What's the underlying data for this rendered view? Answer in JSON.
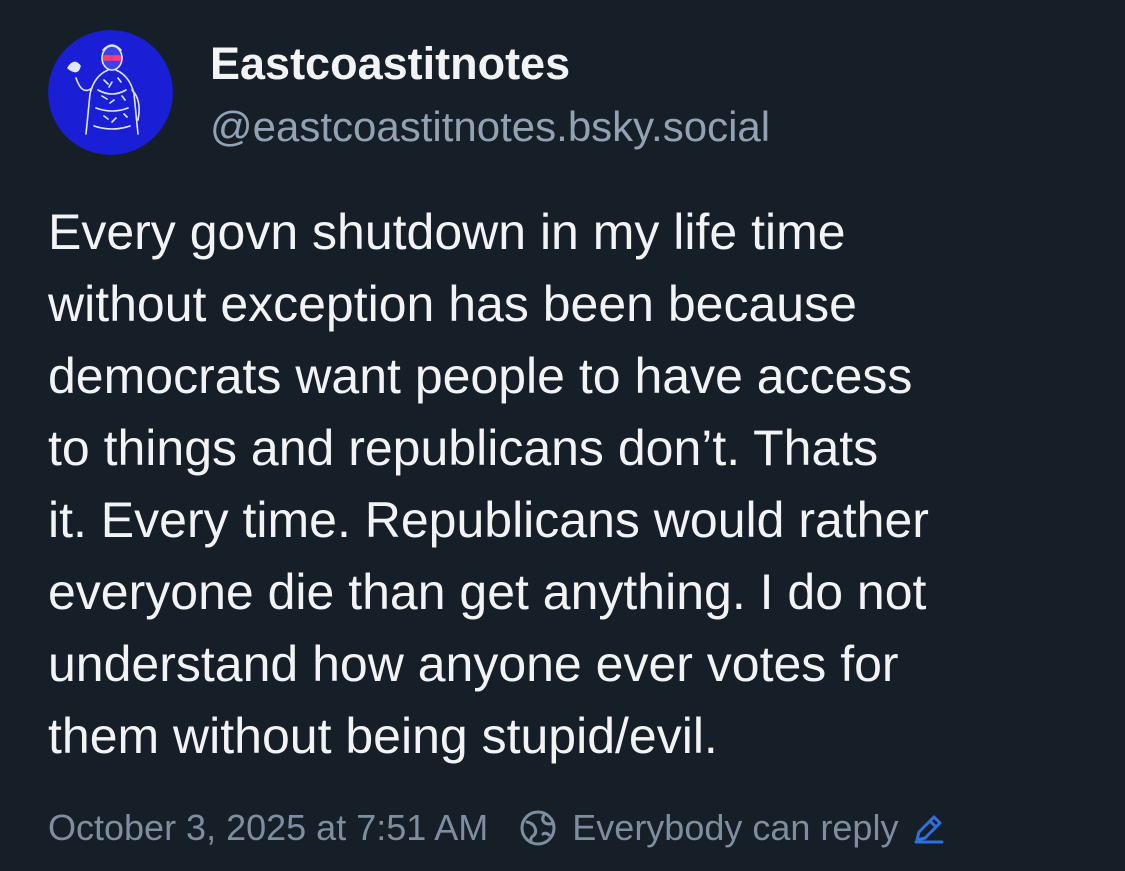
{
  "author": {
    "display_name": "Eastcoastitnotes",
    "handle": "@eastcoastitnotes.bsky.social",
    "avatar_icon": "avatar-icon"
  },
  "post": {
    "lines": [
      "Every govn shutdown in my life time",
      "without exception has been because",
      "democrats want people to have access",
      "to things and republicans don’t. Thats",
      "it. Every time. Republicans would rather",
      "everyone die than get anything. I do not",
      "understand how anyone ever votes for",
      "them without being stupid/evil."
    ]
  },
  "meta": {
    "timestamp": "October 3, 2025 at 7:51 AM",
    "reply_setting": "Everybody can reply",
    "reply_icon": "globe-icon",
    "edit_icon": "pencil-icon"
  },
  "colors": {
    "background": "#161e27",
    "text_primary": "#f1f3f5",
    "text_secondary": "#93a2b3",
    "accent": "#2f6fe0",
    "avatar_bg": "#1a1fd6"
  }
}
